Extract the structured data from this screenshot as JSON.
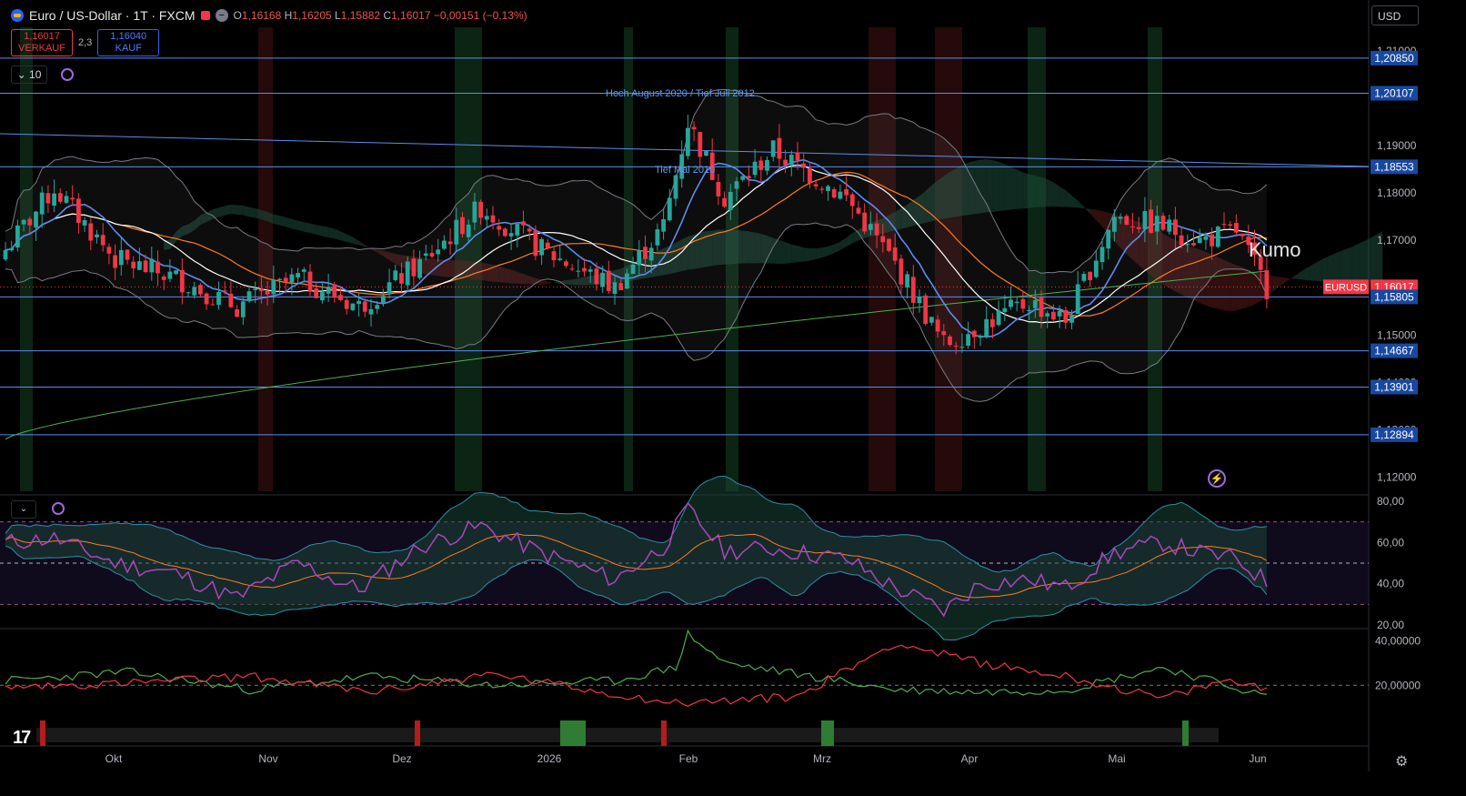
{
  "header": {
    "title": "Euro / US-Dollar · 1T · FXCM",
    "open_label": "O",
    "open": "1,16168",
    "high_label": "H",
    "high": "1,16205",
    "low_label": "L",
    "low": "1,15882",
    "close_label": "C",
    "close": "1,16017",
    "change": "−0,00151 (−0,13%)"
  },
  "trade": {
    "sell_price": "1,16017",
    "sell_label": "VERKAUF",
    "spread": "2,3",
    "buy_price": "1,16040",
    "buy_label": "KAUF"
  },
  "indicator_count": "10",
  "currency": "USD",
  "annotations": {
    "kumo": "Kumo",
    "high_august": "Hoch August 2020 / Tief Juli 2012",
    "tief_mai": "Tief Mai 2010"
  },
  "symbol_tag": "EURUSD",
  "colors": {
    "bull": "#26a69a",
    "bear": "#f23645",
    "level_line": "#5b8def",
    "level_badge": "#1848a0",
    "rsi": "#ab47bc",
    "ma_orange": "#ff7c1f",
    "ma200": "#4caf50",
    "tenkan": "#5b8def"
  },
  "icons": [
    "tradingview-logo-icon",
    "settings-gear-icon",
    "lightning-icon",
    "refresh-icon",
    "chevron-down-icon"
  ],
  "chart_data": [
    {
      "type": "candlestick",
      "title": "Euro / US-Dollar · 1T · FXCM",
      "x_labels": [
        "Okt",
        "Nov",
        "Dez",
        "2026",
        "Feb",
        "Mrz",
        "Apr",
        "Mai",
        "Jun"
      ],
      "y_ticks": [
        "1,21000",
        "1,19000",
        "1,18000",
        "1,17000",
        "1,15000",
        "1,14000",
        "1,13000",
        "1,12000"
      ],
      "ylim": [
        1.117,
        1.215
      ],
      "levels": [
        {
          "value": 1.2085,
          "label": "1,20850"
        },
        {
          "value": 1.20107,
          "label": "1,20107"
        },
        {
          "value": 1.18553,
          "label": "1,18553"
        },
        {
          "value": 1.16017,
          "label": "1,16017"
        },
        {
          "value": 1.15805,
          "label": "1,15805"
        },
        {
          "value": 1.14667,
          "label": "1,14667"
        },
        {
          "value": 1.13901,
          "label": "1,13901"
        },
        {
          "value": 1.12894,
          "label": "1,12894"
        }
      ],
      "close_anchors": [
        [
          0,
          1.168
        ],
        [
          8,
          1.181
        ],
        [
          18,
          1.166
        ],
        [
          28,
          1.162
        ],
        [
          38,
          1.156
        ],
        [
          48,
          1.162
        ],
        [
          58,
          1.156
        ],
        [
          68,
          1.165
        ],
        [
          78,
          1.177
        ],
        [
          88,
          1.168
        ],
        [
          100,
          1.16
        ],
        [
          108,
          1.173
        ],
        [
          112,
          1.195
        ],
        [
          118,
          1.179
        ],
        [
          126,
          1.189
        ],
        [
          138,
          1.179
        ],
        [
          146,
          1.165
        ],
        [
          154,
          1.148
        ],
        [
          160,
          1.152
        ],
        [
          168,
          1.157
        ],
        [
          174,
          1.153
        ],
        [
          182,
          1.175
        ],
        [
          190,
          1.173
        ],
        [
          196,
          1.17
        ],
        [
          202,
          1.172
        ],
        [
          207,
          1.16
        ]
      ]
    },
    {
      "type": "line",
      "title": "RSI",
      "y_ticks": [
        "80,00",
        "60,00",
        "40,00",
        "20,00"
      ],
      "ylim": [
        20,
        80
      ],
      "bands": [
        70,
        50,
        30
      ],
      "rsi_anchors": [
        [
          0,
          60
        ],
        [
          8,
          62
        ],
        [
          18,
          50
        ],
        [
          28,
          45
        ],
        [
          38,
          33
        ],
        [
          48,
          50
        ],
        [
          58,
          37
        ],
        [
          68,
          58
        ],
        [
          78,
          68
        ],
        [
          88,
          55
        ],
        [
          100,
          42
        ],
        [
          108,
          58
        ],
        [
          112,
          76
        ],
        [
          118,
          56
        ],
        [
          126,
          57
        ],
        [
          138,
          52
        ],
        [
          146,
          38
        ],
        [
          154,
          27
        ],
        [
          160,
          40
        ],
        [
          168,
          42
        ],
        [
          174,
          38
        ],
        [
          182,
          55
        ],
        [
          190,
          60
        ],
        [
          196,
          55
        ],
        [
          202,
          52
        ],
        [
          207,
          41
        ]
      ]
    },
    {
      "type": "line",
      "title": "DMI",
      "y_ticks": [
        "40,00000",
        "20,00000"
      ],
      "ylim": [
        5,
        45
      ],
      "series": [
        {
          "values": [
            [
              0,
              22
            ],
            [
              20,
              26
            ],
            [
              40,
              18
            ],
            [
              60,
              24
            ],
            [
              80,
              20
            ],
            [
              100,
              22
            ],
            [
              110,
              28
            ],
            [
              112,
              43
            ],
            [
              118,
              30
            ],
            [
              130,
              25
            ],
            [
              146,
              18
            ],
            [
              160,
              17
            ],
            [
              174,
              18
            ],
            [
              190,
              28
            ],
            [
              207,
              15
            ]
          ]
        },
        {
          "values": [
            [
              0,
              19
            ],
            [
              20,
              21
            ],
            [
              40,
              24
            ],
            [
              60,
              17
            ],
            [
              80,
              25
            ],
            [
              100,
              16
            ],
            [
              110,
              12
            ],
            [
              118,
              13
            ],
            [
              130,
              15
            ],
            [
              140,
              30
            ],
            [
              146,
              39
            ],
            [
              160,
              30
            ],
            [
              174,
              24
            ],
            [
              190,
              14
            ],
            [
              200,
              22
            ],
            [
              207,
              19
            ]
          ]
        }
      ]
    }
  ]
}
